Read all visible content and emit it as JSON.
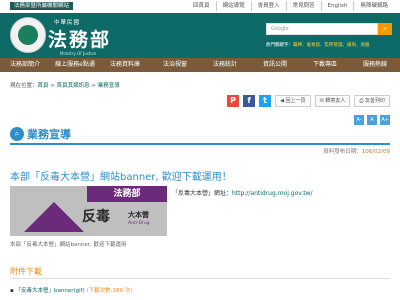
{
  "topbar": {
    "gov_tag": "法務部暨所屬機關網站",
    "links": [
      "回首頁",
      "網站導覽",
      "會員登入",
      "常見問答",
      "English",
      "無障礙網路"
    ]
  },
  "header": {
    "org_small": "中華民國",
    "org_name": "法務部",
    "org_en": "Ministry Of Justice",
    "search_placeholder": "Google",
    "search_icon": "magnifier-icon",
    "hot_label": "熱門關鍵字：",
    "hot_keywords": "羈押、會易罰、監所管理、緩刑、易服"
  },
  "nav": [
    "法務部簡介",
    "線上服務e點通",
    "法務資料庫",
    "法治視窗",
    "法務統計",
    "資訊公開",
    "下載專區",
    "服務熱線"
  ],
  "breadcrumb": {
    "prefix": "現在位置：",
    "items": [
      "首頁",
      "首頁其類訊息",
      "業務宣導"
    ]
  },
  "tools": {
    "social_icons": [
      "plurk-icon",
      "facebook-icon",
      "twitter-icon"
    ],
    "back": "回上一頁",
    "share": "轉寄友人",
    "print": "友善列印",
    "font_sizes": [
      "A-",
      "A",
      "A+"
    ]
  },
  "section": {
    "title": "業務宣導",
    "pubdate_label": "資料發布日期：",
    "pubdate": "106/02/09"
  },
  "article": {
    "headline": "本部「反毒大本營」網站banner, 歡迎下載運用！",
    "banner_org": "法務部",
    "banner_main": "反毒",
    "banner_sub": "大本營",
    "banner_en": "Anti-Drug",
    "caption": "本部「反毒大本營」網站banner, 歡迎下載運用",
    "site_label": "「反毒大本營」網址：",
    "site_url": "http://antidrug.moj.gov.tw/"
  },
  "attachments": {
    "heading": "附件下載",
    "items": [
      {
        "name": "「反毒大本營」banner(gif)",
        "count": "(下載次數:160 次)"
      }
    ]
  }
}
